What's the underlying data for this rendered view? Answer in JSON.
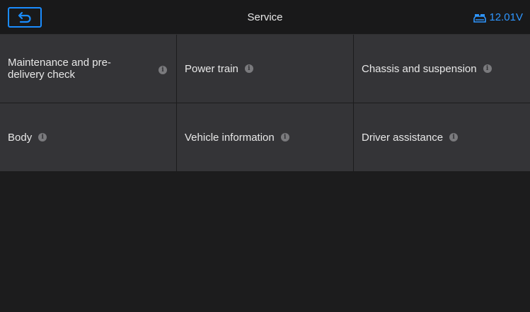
{
  "header": {
    "title": "Service",
    "battery_voltage": "12.01V",
    "back_icon": "back-arrow-icon",
    "battery_icon": "car-battery-icon"
  },
  "menu": {
    "items": [
      {
        "label": "Maintenance and pre-delivery check",
        "icon": "info-icon"
      },
      {
        "label": "Power train",
        "icon": "info-icon"
      },
      {
        "label": "Chassis and suspension",
        "icon": "info-icon"
      },
      {
        "label": "Body",
        "icon": "info-icon"
      },
      {
        "label": "Vehicle information",
        "icon": "info-icon"
      },
      {
        "label": "Driver assistance",
        "icon": "info-icon"
      }
    ]
  },
  "colors": {
    "accent": "#1a8cff",
    "tile": "#343437",
    "background": "#1c1c1d"
  }
}
